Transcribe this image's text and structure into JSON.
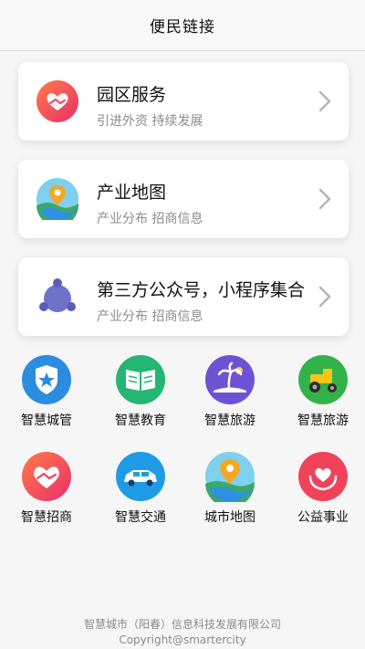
{
  "header": {
    "title": "便民链接"
  },
  "cards": [
    {
      "title": "园区服务",
      "subtitle": "引进外资 持续发展",
      "icon": "handshake-heart-icon"
    },
    {
      "title": "产业地图",
      "subtitle": "产业分布 招商信息",
      "icon": "map-pin-icon"
    },
    {
      "title": "第三方公众号，小程序集合",
      "subtitle": "产业分布 招商信息",
      "icon": "network-nodes-icon"
    }
  ],
  "grid": [
    {
      "label": "智慧城管",
      "icon": "shield-star-icon"
    },
    {
      "label": "智慧教育",
      "icon": "book-icon"
    },
    {
      "label": "智慧旅游",
      "icon": "palm-tree-icon"
    },
    {
      "label": "智慧旅游",
      "icon": "tractor-icon"
    },
    {
      "label": "智慧招商",
      "icon": "handshake-heart-icon"
    },
    {
      "label": "智慧交通",
      "icon": "car-icon"
    },
    {
      "label": "城市地图",
      "icon": "map-pin-icon"
    },
    {
      "label": "公益事业",
      "icon": "heart-hands-icon"
    }
  ],
  "footer": {
    "company": "智慧城市（阳春）信息科技发展有限公司",
    "copyright": "Copyright@smartercity"
  },
  "colors": {
    "accent_red": "#f0435a",
    "accent_blue": "#2f8fe0",
    "accent_green": "#25b673",
    "accent_purple": "#6c53d6"
  }
}
